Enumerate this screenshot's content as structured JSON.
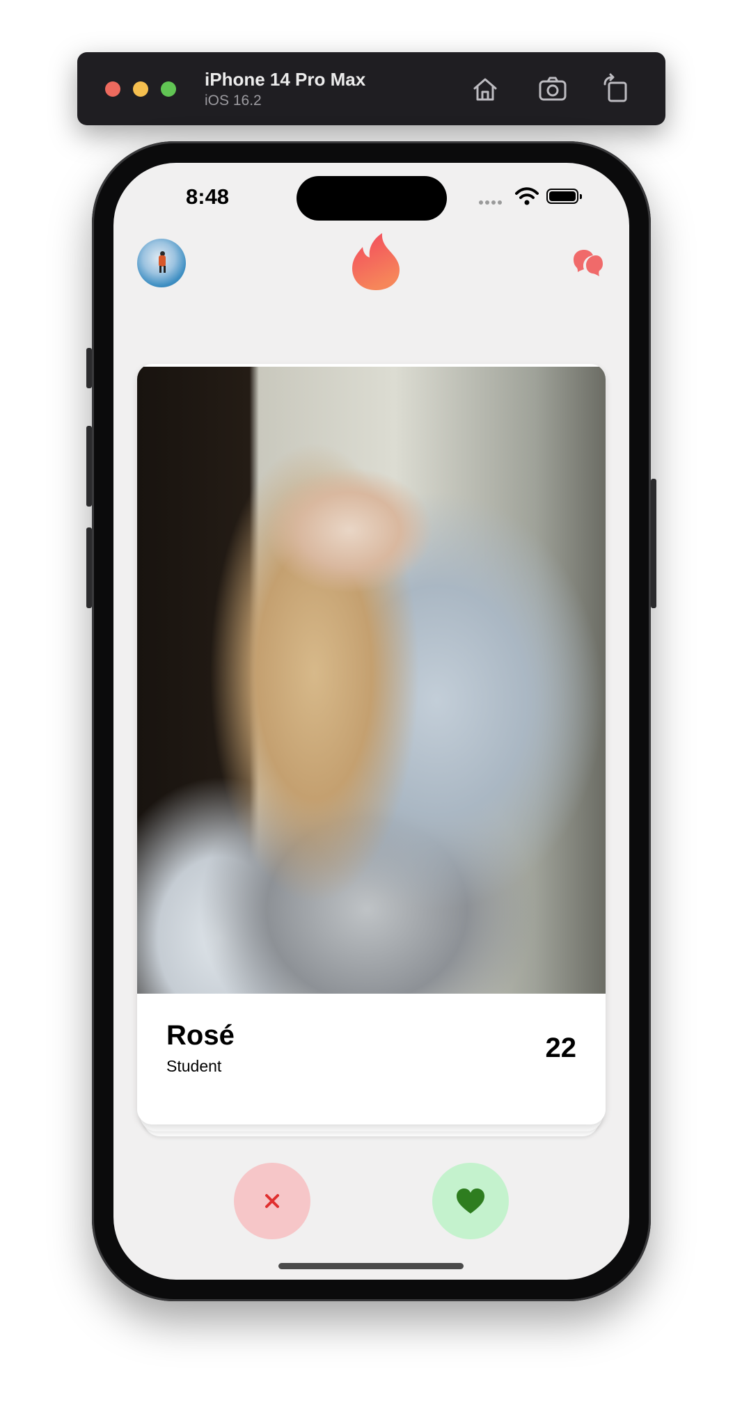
{
  "simulator": {
    "device_name": "iPhone 14 Pro Max",
    "os_version": "iOS 16.2",
    "toolbar_icons": [
      "home-icon",
      "screenshot-icon",
      "rotate-icon"
    ]
  },
  "status_bar": {
    "time": "8:48",
    "icons": [
      "signal-dots-icon",
      "wifi-icon",
      "battery-icon"
    ]
  },
  "header": {
    "avatar_icon": "profile-avatar",
    "logo_icon": "flame-icon",
    "chat_icon": "chat-bubbles-icon",
    "accent_color": "#f06a6a"
  },
  "card": {
    "name": "Rosé",
    "occupation": "Student",
    "age": "22",
    "photo_icon": "profile-photo"
  },
  "actions": {
    "nope_icon": "close-icon",
    "like_icon": "heart-icon",
    "nope_color": "#e02f2f",
    "like_color": "#2e7d1f"
  }
}
